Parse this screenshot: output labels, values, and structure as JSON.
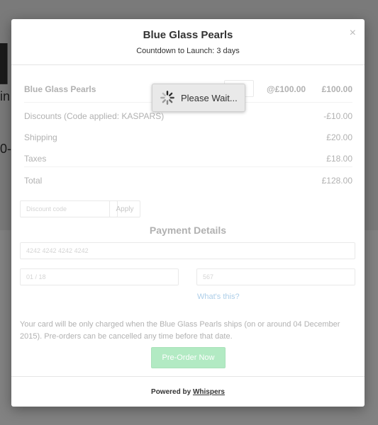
{
  "background": {
    "fragment_letter": "l",
    "fragment_in": "in",
    "fragment_number": "0-"
  },
  "modal": {
    "title": "Blue Glass Pearls",
    "subtitle": "Countdown to Launch: 3 days",
    "close_symbol": "×"
  },
  "order": {
    "product_name": "Blue Glass Pearls",
    "unit_price": "@£100.00",
    "line_total": "£100.00",
    "discount_label": "Discounts (Code applied: KASPARS)",
    "discount_value": "-£10.00",
    "shipping_label": "Shipping",
    "shipping_value": "£20.00",
    "taxes_label": "Taxes",
    "taxes_value": "£18.00",
    "total_label": "Total",
    "total_value": "£128.00"
  },
  "discount": {
    "placeholder": "Discount code",
    "apply_label": "Apply"
  },
  "payment": {
    "title": "Payment Details",
    "card_number": "4242 4242 4242 4242",
    "expiry": "01 / 18",
    "cvc": "567",
    "whats_this": "What's this?"
  },
  "note": "Your card will be only charged when the Blue Glass Pearls ships (on or around 04 December 2015). Pre-orders can be cancelled any time before that date.",
  "preorder_button": "Pre-Order Now",
  "footer": {
    "powered_prefix": "Powered by",
    "powered_link": "Whispers"
  },
  "overlay": {
    "wait_text": "Please Wait...",
    "icon": "spinner-icon"
  }
}
